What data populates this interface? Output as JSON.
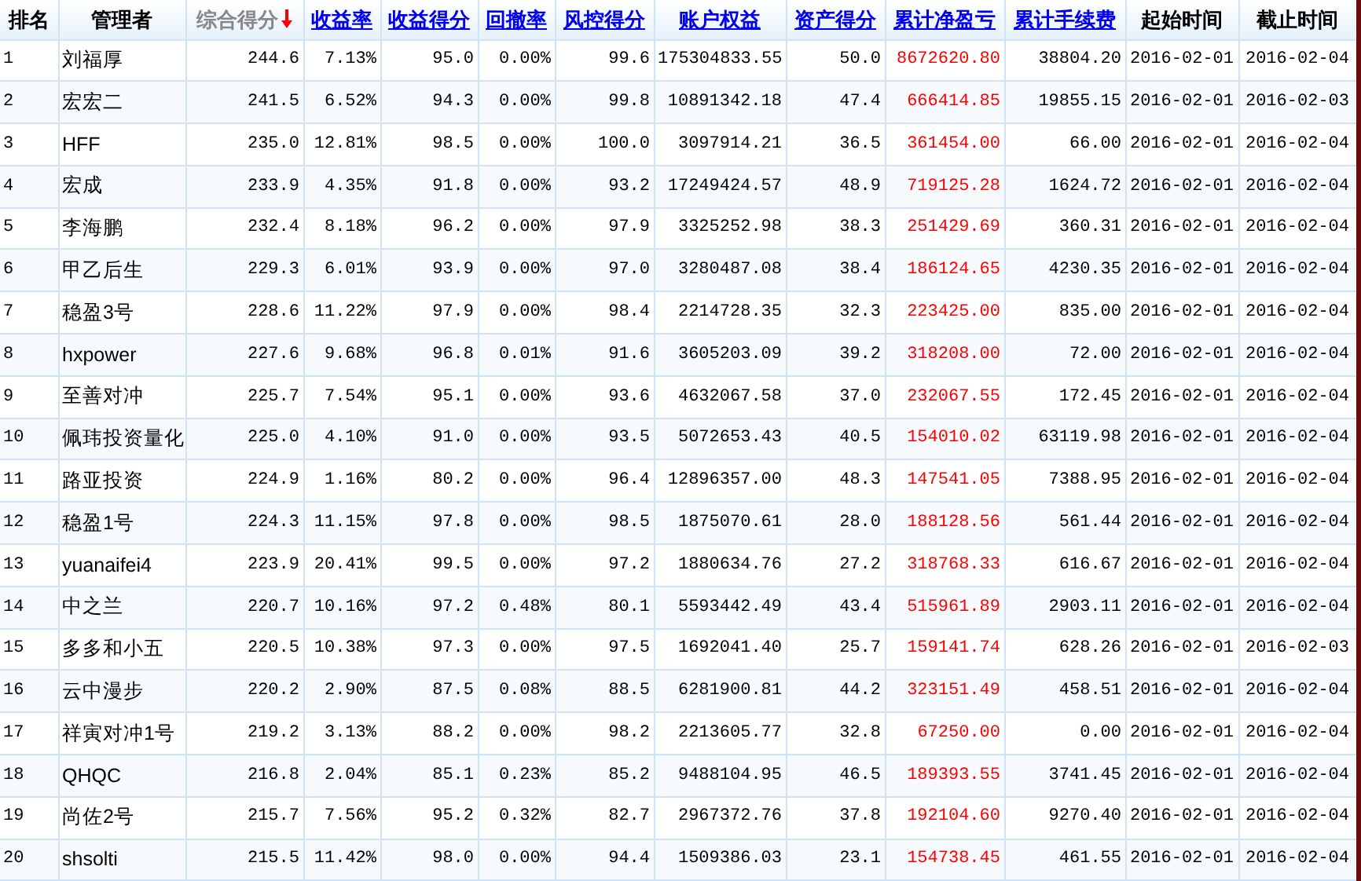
{
  "table": {
    "columns": [
      {
        "label": "排名",
        "kind": "plain",
        "red_values": false
      },
      {
        "label": "管理者",
        "kind": "plain",
        "red_values": false
      },
      {
        "label": "综合得分",
        "kind": "sorted",
        "red_values": false
      },
      {
        "label": "收益率",
        "kind": "link",
        "red_values": false
      },
      {
        "label": "收益得分",
        "kind": "link",
        "red_values": false
      },
      {
        "label": "回撤率",
        "kind": "link",
        "red_values": false
      },
      {
        "label": "风控得分",
        "kind": "link",
        "red_values": false
      },
      {
        "label": "账户权益",
        "kind": "link",
        "red_values": false
      },
      {
        "label": "资产得分",
        "kind": "link",
        "red_values": false
      },
      {
        "label": "累计净盈亏",
        "kind": "link",
        "red_values": true
      },
      {
        "label": "累计手续费",
        "kind": "link",
        "red_values": false
      },
      {
        "label": "起始时间",
        "kind": "plain",
        "red_values": false
      },
      {
        "label": "截止时间",
        "kind": "plain",
        "red_values": false
      }
    ],
    "rows": [
      [
        "1",
        "刘福厚",
        "244.6",
        "7.13%",
        "95.0",
        "0.00%",
        "99.6",
        "175304833.55",
        "50.0",
        "8672620.80",
        "38804.20",
        "2016-02-01",
        "2016-02-04"
      ],
      [
        "2",
        "宏宏二",
        "241.5",
        "6.52%",
        "94.3",
        "0.00%",
        "99.8",
        "10891342.18",
        "47.4",
        "666414.85",
        "19855.15",
        "2016-02-01",
        "2016-02-03"
      ],
      [
        "3",
        "HFF",
        "235.0",
        "12.81%",
        "98.5",
        "0.00%",
        "100.0",
        "3097914.21",
        "36.5",
        "361454.00",
        "66.00",
        "2016-02-01",
        "2016-02-04"
      ],
      [
        "4",
        "宏成",
        "233.9",
        "4.35%",
        "91.8",
        "0.00%",
        "93.2",
        "17249424.57",
        "48.9",
        "719125.28",
        "1624.72",
        "2016-02-01",
        "2016-02-04"
      ],
      [
        "5",
        "李海鹏",
        "232.4",
        "8.18%",
        "96.2",
        "0.00%",
        "97.9",
        "3325252.98",
        "38.3",
        "251429.69",
        "360.31",
        "2016-02-01",
        "2016-02-04"
      ],
      [
        "6",
        "甲乙后生",
        "229.3",
        "6.01%",
        "93.9",
        "0.00%",
        "97.0",
        "3280487.08",
        "38.4",
        "186124.65",
        "4230.35",
        "2016-02-01",
        "2016-02-04"
      ],
      [
        "7",
        "稳盈3号",
        "228.6",
        "11.22%",
        "97.9",
        "0.00%",
        "98.4",
        "2214728.35",
        "32.3",
        "223425.00",
        "835.00",
        "2016-02-01",
        "2016-02-04"
      ],
      [
        "8",
        "hxpower",
        "227.6",
        "9.68%",
        "96.8",
        "0.01%",
        "91.6",
        "3605203.09",
        "39.2",
        "318208.00",
        "72.00",
        "2016-02-01",
        "2016-02-04"
      ],
      [
        "9",
        "至善对冲",
        "225.7",
        "7.54%",
        "95.1",
        "0.00%",
        "93.6",
        "4632067.58",
        "37.0",
        "232067.55",
        "172.45",
        "2016-02-01",
        "2016-02-04"
      ],
      [
        "10",
        "佩玮投资量化",
        "225.0",
        "4.10%",
        "91.0",
        "0.00%",
        "93.5",
        "5072653.43",
        "40.5",
        "154010.02",
        "63119.98",
        "2016-02-01",
        "2016-02-04"
      ],
      [
        "11",
        "路亚投资",
        "224.9",
        "1.16%",
        "80.2",
        "0.00%",
        "96.4",
        "12896357.00",
        "48.3",
        "147541.05",
        "7388.95",
        "2016-02-01",
        "2016-02-04"
      ],
      [
        "12",
        "稳盈1号",
        "224.3",
        "11.15%",
        "97.8",
        "0.00%",
        "98.5",
        "1875070.61",
        "28.0",
        "188128.56",
        "561.44",
        "2016-02-01",
        "2016-02-04"
      ],
      [
        "13",
        "yuanaifei4",
        "223.9",
        "20.41%",
        "99.5",
        "0.00%",
        "97.2",
        "1880634.76",
        "27.2",
        "318768.33",
        "616.67",
        "2016-02-01",
        "2016-02-04"
      ],
      [
        "14",
        "中之兰",
        "220.7",
        "10.16%",
        "97.2",
        "0.48%",
        "80.1",
        "5593442.49",
        "43.4",
        "515961.89",
        "2903.11",
        "2016-02-01",
        "2016-02-04"
      ],
      [
        "15",
        "多多和小五",
        "220.5",
        "10.38%",
        "97.3",
        "0.00%",
        "97.5",
        "1692041.40",
        "25.7",
        "159141.74",
        "628.26",
        "2016-02-01",
        "2016-02-03"
      ],
      [
        "16",
        "云中漫步",
        "220.2",
        "2.90%",
        "87.5",
        "0.08%",
        "88.5",
        "6281900.81",
        "44.2",
        "323151.49",
        "458.51",
        "2016-02-01",
        "2016-02-04"
      ],
      [
        "17",
        "祥寅对冲1号",
        "219.2",
        "3.13%",
        "88.2",
        "0.00%",
        "98.2",
        "2213605.77",
        "32.8",
        "67250.00",
        "0.00",
        "2016-02-01",
        "2016-02-04"
      ],
      [
        "18",
        "QHQC",
        "216.8",
        "2.04%",
        "85.1",
        "0.23%",
        "85.2",
        "9488104.95",
        "46.5",
        "189393.55",
        "3741.45",
        "2016-02-01",
        "2016-02-04"
      ],
      [
        "19",
        "尚佐2号",
        "215.7",
        "7.56%",
        "95.2",
        "0.32%",
        "82.7",
        "2967372.76",
        "37.8",
        "192104.60",
        "9270.40",
        "2016-02-01",
        "2016-02-04"
      ],
      [
        "20",
        "shsolti",
        "215.5",
        "11.42%",
        "98.0",
        "0.00%",
        "94.4",
        "1509386.03",
        "23.1",
        "154738.45",
        "461.55",
        "2016-02-01",
        "2016-02-04"
      ]
    ]
  }
}
